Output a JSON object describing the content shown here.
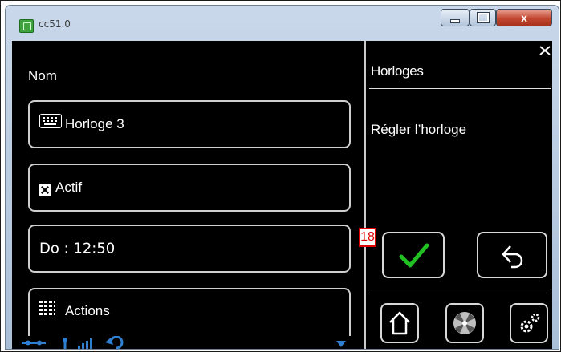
{
  "window": {
    "title": "cc51.0",
    "close_glyph": "x"
  },
  "left_panel": {
    "name_label": "Nom",
    "clock_name": "Horloge 3",
    "active_label": "Actif",
    "active_checked": true,
    "schedule_value": "Do : 12:50",
    "actions_label": "Actions"
  },
  "right_panel": {
    "heading": "Horloges",
    "description": "Régler l’horloge"
  },
  "annotation": {
    "marker_number": "18"
  },
  "colors": {
    "screen_background": "#000000",
    "text": "#ffffff",
    "field_border": "#cfcfcf",
    "confirm_check": "#22c022",
    "status_icons": "#2f7fd0",
    "marker": "#e00000"
  },
  "icons": {
    "keyboard": "keyboard-icon",
    "checkbox": "checkbox-checked-icon",
    "grid": "grid-icon",
    "confirm": "checkmark-icon",
    "back": "back-arrow-icon",
    "home": "home-icon",
    "fan": "fan-icon",
    "settings": "gears-icon",
    "close_panel": "close-x-icon"
  }
}
